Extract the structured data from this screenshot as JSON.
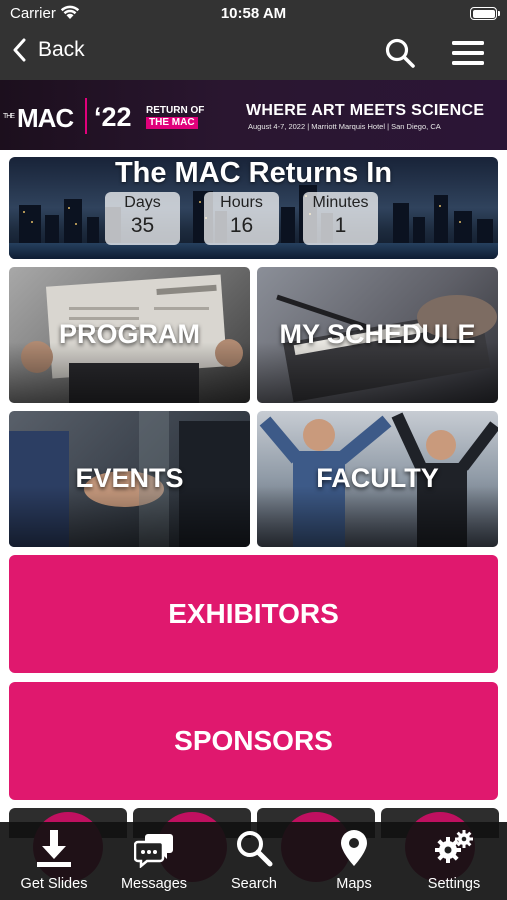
{
  "status_bar": {
    "carrier": "Carrier",
    "time": "10:58 AM"
  },
  "nav": {
    "back_label": "Back"
  },
  "banner": {
    "logo_prefix": "THE",
    "logo": "MAC",
    "year": "‘22",
    "tagline_line1": "RETURN OF",
    "tagline_line2": "THE MAC",
    "headline": "WHERE ART MEETS SCIENCE",
    "details": "August 4-7, 2022 | Marriott Marquis Hotel | San Diego, CA"
  },
  "countdown": {
    "title": "The MAC Returns In",
    "units": [
      {
        "label": "Days",
        "value": "35"
      },
      {
        "label": "Hours",
        "value": "16"
      },
      {
        "label": "Minutes",
        "value": "1"
      }
    ]
  },
  "tiles": {
    "program": "PROGRAM",
    "my_schedule": "MY SCHEDULE",
    "events": "EVENTS",
    "faculty": "FACULTY"
  },
  "buttons": {
    "exhibitors": "EXHIBITORS",
    "sponsors": "SPONSORS"
  },
  "tabbar": [
    {
      "label": "Get Slides",
      "icon": "download-icon"
    },
    {
      "label": "Messages",
      "icon": "chat-bubbles-icon"
    },
    {
      "label": "Search",
      "icon": "search-icon"
    },
    {
      "label": "Maps",
      "icon": "map-pin-icon"
    },
    {
      "label": "Settings",
      "icon": "gears-icon"
    }
  ],
  "colors": {
    "header": "#333333",
    "accent_pink": "#e0186e",
    "tabbar": "#111111"
  }
}
